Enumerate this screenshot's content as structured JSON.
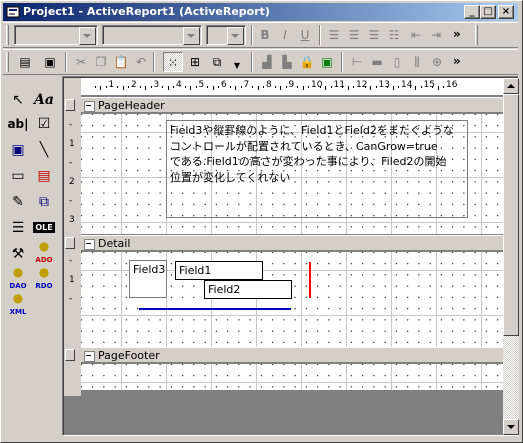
{
  "window": {
    "title": "Project1 - ActiveReport1 (ActiveReport)",
    "min_glyph": "_",
    "max_glyph": "□",
    "close_glyph": "×"
  },
  "format_toolbar": {
    "bold": "B",
    "italic": "I",
    "underline": "U",
    "overflow": "»"
  },
  "standard_toolbar": {
    "overflow": "»"
  },
  "toolbox": {
    "label_tool": "Aa",
    "textbox_tool": "ab|",
    "ole_tool": "OLE",
    "ado_label": "ADO",
    "dao_label": "DAO",
    "rdo_label": "RDO",
    "xml_label": "XML"
  },
  "ruler": {
    "numbers": [
      "1",
      "2",
      "3",
      "4",
      "5",
      "6",
      "7",
      "8",
      "9",
      "10",
      "11",
      "12",
      "13",
      "14",
      "15",
      "16"
    ]
  },
  "vertical_ruler": {
    "header_marks": [
      "-",
      "1",
      "-",
      "2",
      "-",
      "3"
    ],
    "detail_marks": [
      "-",
      "1",
      "-"
    ]
  },
  "sections": {
    "page_header": "PageHeader",
    "detail": "Detail",
    "page_footer": "PageFooter"
  },
  "header_label": {
    "line1": "Field3や縦罫線のように、Field1とField2をまたぐような",
    "line2": "コントロールが配置されているとき、CanGrow=true",
    "line3": "である.Field1の高さが変わった事により、Filed2の開始",
    "line4": "位置が変化してくれない"
  },
  "detail_fields": {
    "field3": "Field3",
    "field1": "Field1",
    "field2": "Field2"
  },
  "colors": {
    "title_start": "#0a246a",
    "title_end": "#a6caf0",
    "vertical_line": "#ff0000",
    "horizontal_line": "#0000c0"
  }
}
